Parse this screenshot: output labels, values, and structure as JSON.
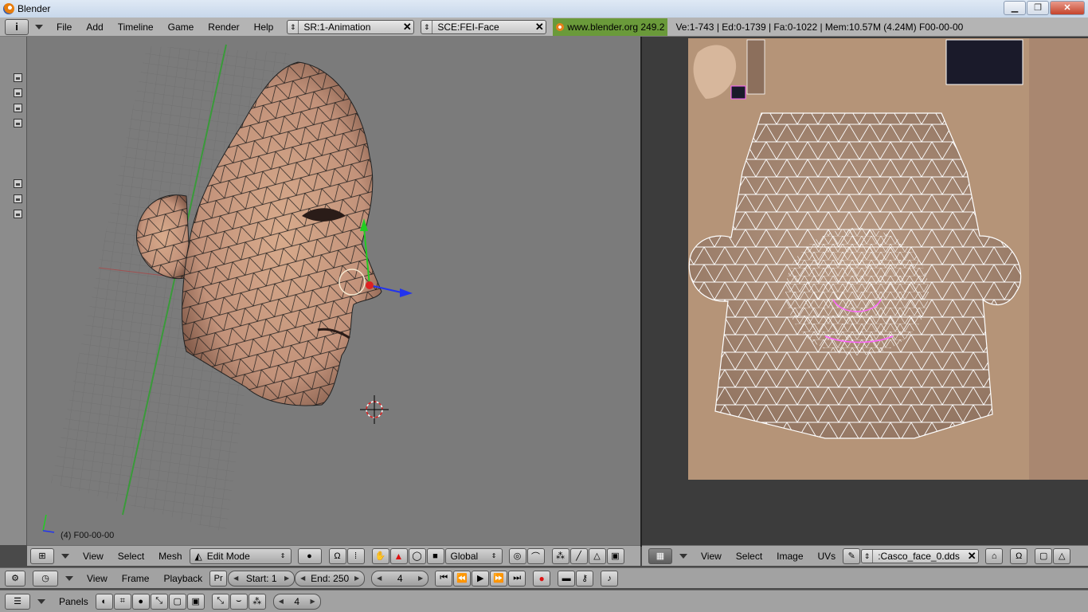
{
  "window": {
    "title": "Blender"
  },
  "window_controls": {
    "minimize": "▁",
    "maximize": "❐",
    "close": "✕"
  },
  "info_header": {
    "icon_label": "i",
    "menus": [
      "File",
      "Add",
      "Timeline",
      "Game",
      "Render",
      "Help"
    ],
    "screen_field": "SR:1-Animation",
    "scene_field": "SCE:FEI-Face",
    "site_link": "www.blender.org 249.2",
    "stats": "Ve:1-743 | Ed:0-1739 | Fa:0-1022 | Mem:10.57M (4.24M) F00-00-00"
  },
  "viewport3d": {
    "overlay_label": "(4) F00-00-00"
  },
  "view3d_header": {
    "menus": [
      "View",
      "Select",
      "Mesh"
    ],
    "mode_select": "Edit Mode",
    "orientation_select": "Global"
  },
  "image_editor_header": {
    "menus": [
      "View",
      "Select",
      "Image",
      "UVs"
    ],
    "image_name": ":Casco_face_0.dds"
  },
  "timeline_header": {
    "menus": [
      "View",
      "Frame",
      "Playback"
    ],
    "pr_label": "Pr",
    "start": "Start: 1",
    "end": "End: 250",
    "current_frame": "4"
  },
  "buttons_header": {
    "panels_label": "Panels",
    "frame_field": "4"
  },
  "colors": {
    "skin": "#c89a7c",
    "wire": "#1a1a1a",
    "uv_wire": "#ffffff",
    "uv_selected": "#ff66ff",
    "axis_green": "#22cc22",
    "axis_blue": "#2233ee",
    "axis_red": "#dd2222"
  }
}
